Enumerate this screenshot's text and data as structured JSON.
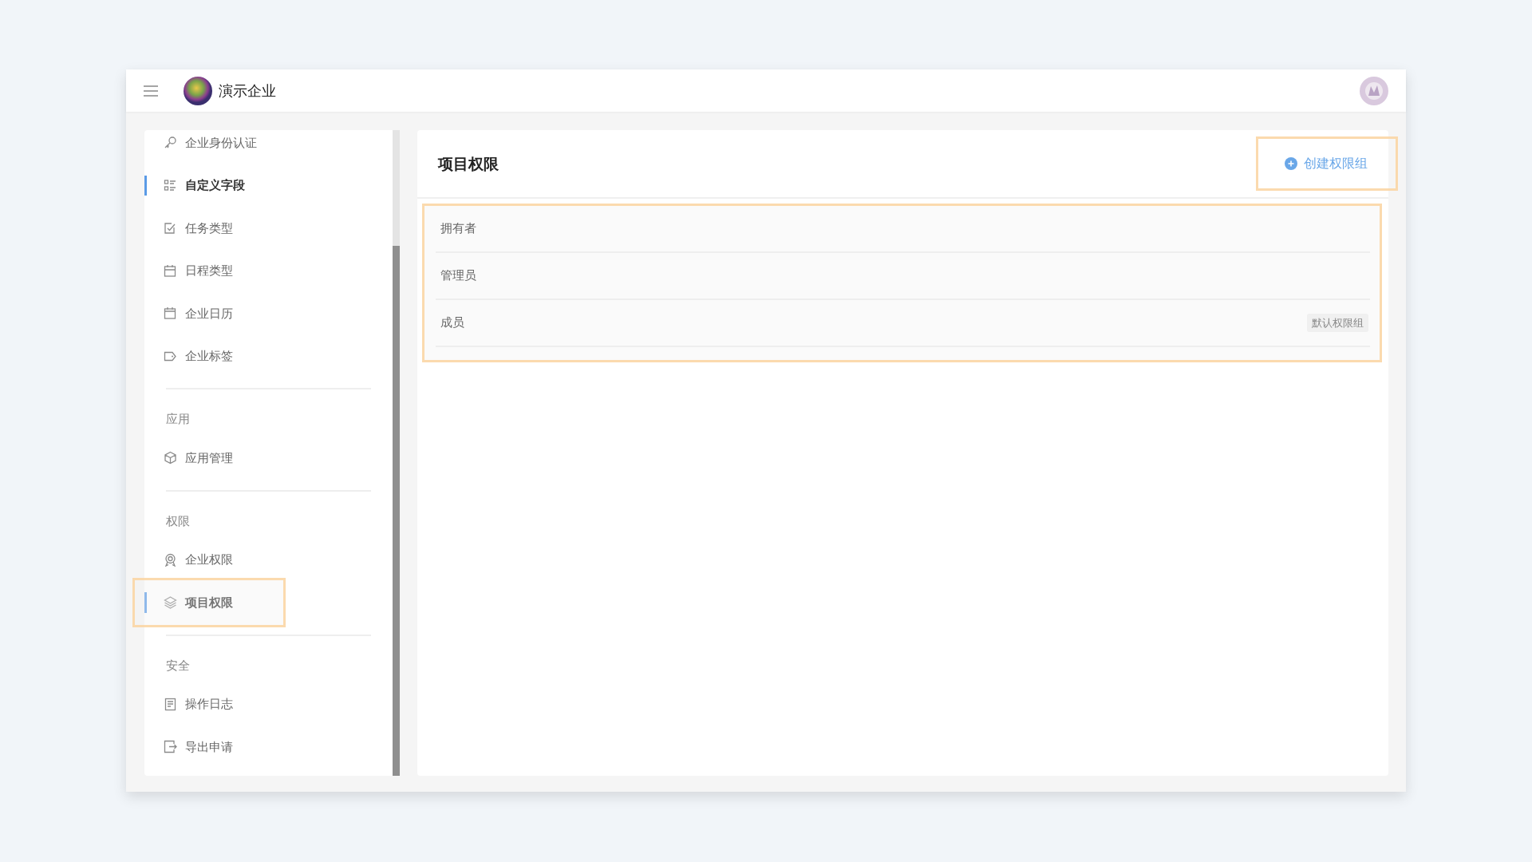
{
  "header": {
    "company": "演示企业"
  },
  "sidebar": {
    "sections": [
      {
        "items": [
          {
            "label": "企业身份认证",
            "selected": false,
            "highlighted": false
          },
          {
            "label": "自定义字段",
            "selected": true,
            "highlighted": false
          },
          {
            "label": "任务类型",
            "selected": false,
            "highlighted": false
          },
          {
            "label": "日程类型",
            "selected": false,
            "highlighted": false
          },
          {
            "label": "企业日历",
            "selected": false,
            "highlighted": false
          },
          {
            "label": "企业标签",
            "selected": false,
            "highlighted": false
          }
        ]
      },
      {
        "title": "应用",
        "items": [
          {
            "label": "应用管理",
            "selected": false,
            "highlighted": false
          }
        ]
      },
      {
        "title": "权限",
        "items": [
          {
            "label": "企业权限",
            "selected": false,
            "highlighted": false
          },
          {
            "label": "项目权限",
            "selected": true,
            "highlighted": true
          }
        ]
      },
      {
        "title": "安全",
        "items": [
          {
            "label": "操作日志",
            "selected": false,
            "highlighted": false
          },
          {
            "label": "导出申请",
            "selected": false,
            "highlighted": false
          }
        ]
      }
    ]
  },
  "main": {
    "title": "项目权限",
    "create_button": {
      "label": "创建权限组",
      "highlighted": true
    },
    "groups_highlighted": true,
    "groups": [
      {
        "name": "拥有者"
      },
      {
        "name": "管理员"
      },
      {
        "name": "成员",
        "tag": "默认权限组"
      }
    ]
  }
}
